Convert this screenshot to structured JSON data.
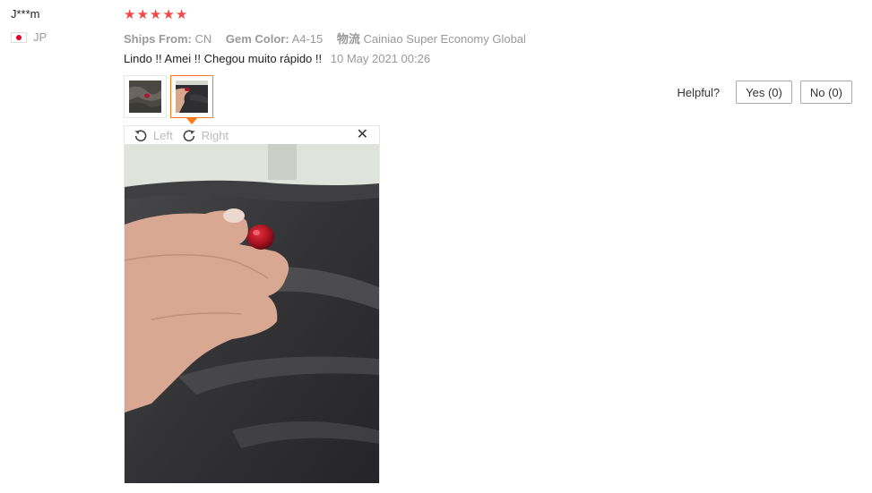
{
  "user": {
    "name": "J***m",
    "country": "JP",
    "flag_icon": "japan-flag-icon"
  },
  "rating": {
    "stars": 5,
    "max": 5,
    "star_icon": "star-icon",
    "color": "#f44848"
  },
  "attributes": [
    {
      "key": "Ships From:",
      "value": "CN"
    },
    {
      "key": "Gem Color:",
      "value": "A4-15"
    },
    {
      "key": "物流",
      "value": "Cainiao Super Economy Global"
    }
  ],
  "review": {
    "text": "Lindo !! Amei !! Chegou muito rápido !!",
    "date": "10 May 2021 00:26"
  },
  "helpful": {
    "label": "Helpful?",
    "yes_label": "Yes (0)",
    "no_label": "No (0)"
  },
  "viewer": {
    "rotate_left_label": "Left",
    "rotate_right_label": "Right",
    "close_icon": "close-icon",
    "active_thumbnail": 2
  },
  "colors": {
    "accent": "#ff7a1a",
    "muted_text": "#999999"
  }
}
